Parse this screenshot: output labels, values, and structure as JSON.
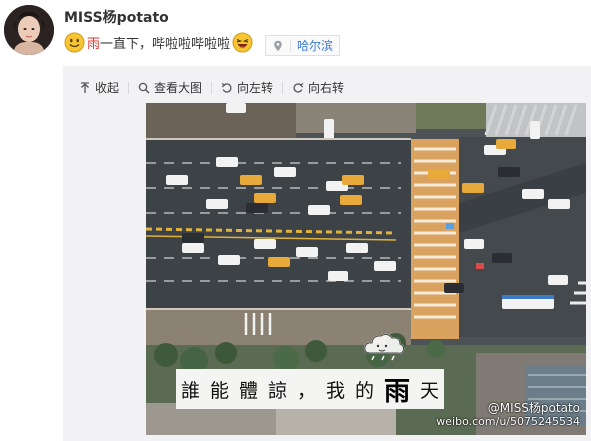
{
  "post": {
    "username": "MISS杨potato",
    "text_rain": "雨",
    "text_rest": "一直下，哔啦啦哔啦啦",
    "location": "哈尔滨"
  },
  "toolbar": {
    "collapse": "收起",
    "view_large": "查看大图",
    "rotate_left": "向左转",
    "rotate_right": "向右转"
  },
  "image": {
    "caption_main": "誰能體諒，我的",
    "caption_rain": "雨",
    "caption_tail": "天",
    "watermark_name": "@MISS杨potato",
    "watermark_url": "weibo.com/u/5075245534"
  },
  "icons": {
    "smile": "smile-emoji-icon",
    "laugh": "laugh-emoji-icon",
    "pin": "location-pin-icon",
    "collapse": "collapse-arrow-icon",
    "search": "magnifier-icon",
    "rotate_left": "rotate-left-icon",
    "rotate_right": "rotate-right-icon",
    "cloud": "cloud-doodle-icon"
  },
  "colors": {
    "link": "#3a7bd5",
    "rain_text": "#dd3333",
    "media_bg": "#f2f2f5"
  }
}
